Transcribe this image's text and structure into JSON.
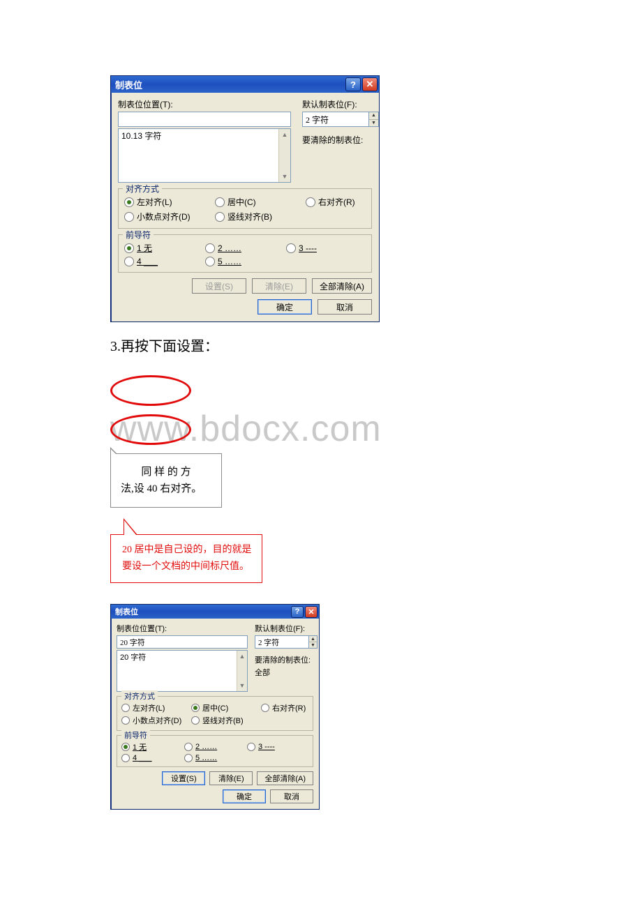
{
  "dialog1": {
    "title": "制表位",
    "tab_pos_label": "制表位位置(T):",
    "tab_pos_value": "",
    "listbox_items": [
      "10.13 字符"
    ],
    "default_tab_label": "默认制表位(F):",
    "default_tab_value": "2 字符",
    "clear_label": "要清除的制表位:",
    "clear_value": "",
    "align_legend": "对齐方式",
    "align": {
      "left": "左对齐(L)",
      "center": "居中(C)",
      "right": "右对齐(R)",
      "decimal": "小数点对齐(D)",
      "bar": "竖线对齐(B)"
    },
    "leader_legend": "前导符",
    "leader": {
      "l1": "1 无",
      "l2": "2 ……",
      "l3": "3 ----",
      "l4": "4 ___",
      "l5": "5 ……"
    },
    "buttons": {
      "set": "设置(S)",
      "clear": "清除(E)",
      "clear_all": "全部清除(A)",
      "ok": "确定",
      "cancel": "取消"
    }
  },
  "step_text": "3.再按下面设置：",
  "watermark": "www.bdocx.com",
  "callout1_l1": "同 样 的 方",
  "callout1_l2": "法,设 40 右对齐。",
  "callout2_text": "20 居中是自己设的，目的就是要设一个文档的中间标尺值。",
  "dialog2": {
    "title": "制表位",
    "tab_pos_label": "制表位位置(T):",
    "tab_pos_value": "20 字符",
    "listbox_items": [
      "20 字符"
    ],
    "default_tab_label": "默认制表位(F):",
    "default_tab_value": "2 字符",
    "clear_label": "要清除的制表位:",
    "clear_value": "全部",
    "align_legend": "对齐方式",
    "align": {
      "left": "左对齐(L)",
      "center": "居中(C)",
      "right": "右对齐(R)",
      "decimal": "小数点对齐(D)",
      "bar": "竖线对齐(B)"
    },
    "leader_legend": "前导符",
    "leader": {
      "l1": "1 无",
      "l2": "2 ……",
      "l3": "3 ----",
      "l4": "4 ___",
      "l5": "5 ……"
    },
    "buttons": {
      "set": "设置(S)",
      "clear": "清除(E)",
      "clear_all": "全部清除(A)",
      "ok": "确定",
      "cancel": "取消"
    }
  }
}
